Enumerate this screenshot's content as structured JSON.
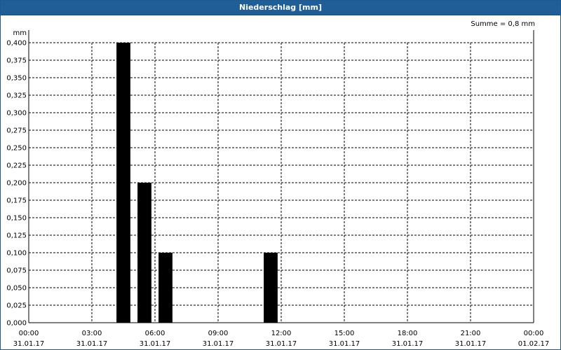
{
  "window": {
    "title": "Niederschlag [mm]"
  },
  "chart_data": {
    "type": "bar",
    "title": "Niederschlag [mm]",
    "ylabel": "mm",
    "annotation": "Summe = 0,8 mm",
    "ylim": [
      0,
      0.4
    ],
    "y_ticks": [
      "0,000",
      "0,025",
      "0,050",
      "0,075",
      "0,100",
      "0,125",
      "0,150",
      "0,175",
      "0,200",
      "0,225",
      "0,250",
      "0,275",
      "0,300",
      "0,325",
      "0,350",
      "0,375",
      "0,400"
    ],
    "x_ticks": [
      {
        "time": "00:00",
        "date": "31.01.17"
      },
      {
        "time": "03:00",
        "date": "31.01.17"
      },
      {
        "time": "06:00",
        "date": "31.01.17"
      },
      {
        "time": "09:00",
        "date": "31.01.17"
      },
      {
        "time": "12:00",
        "date": "31.01.17"
      },
      {
        "time": "15:00",
        "date": "31.01.17"
      },
      {
        "time": "18:00",
        "date": "31.01.17"
      },
      {
        "time": "21:00",
        "date": "31.01.17"
      },
      {
        "time": "00:00",
        "date": "01.02.17"
      }
    ],
    "x_range_hours": [
      0,
      24
    ],
    "bars": [
      {
        "start": "04:00",
        "end": "05:00",
        "value": 0.4
      },
      {
        "start": "05:00",
        "end": "06:00",
        "value": 0.2
      },
      {
        "start": "06:00",
        "end": "07:00",
        "value": 0.1
      },
      {
        "start": "11:00",
        "end": "12:00",
        "value": 0.1
      }
    ],
    "grid": true,
    "colors": {
      "bar": "#000000",
      "grid": "#000000",
      "titlebar": "#1f5e96"
    }
  }
}
